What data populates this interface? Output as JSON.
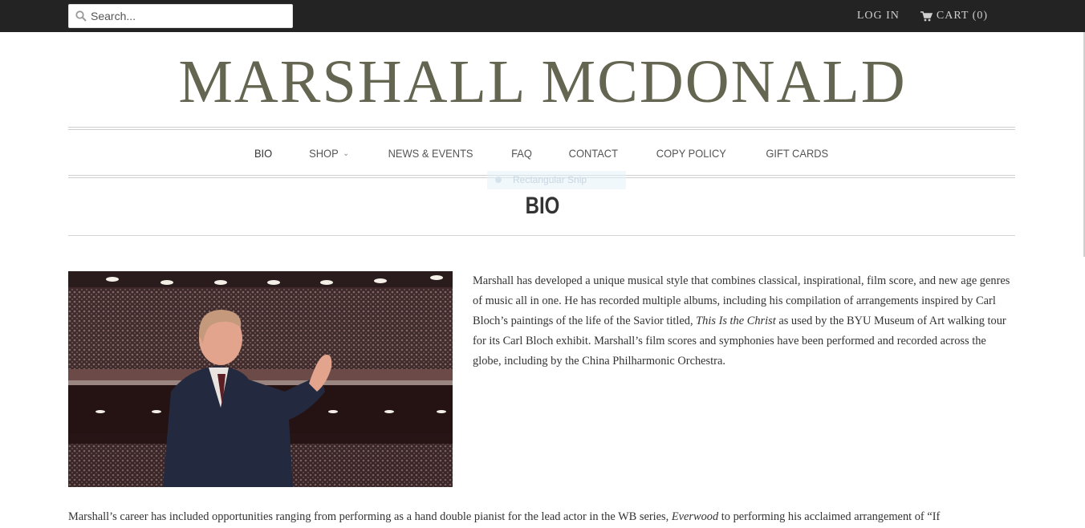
{
  "header": {
    "search_placeholder": "Search...",
    "login_label": "LOG IN",
    "cart_label": "CART (0)"
  },
  "logo": "MARSHALL MCDONALD",
  "nav": {
    "items": [
      {
        "label": "BIO"
      },
      {
        "label": "SHOP"
      },
      {
        "label": "NEWS & EVENTS"
      },
      {
        "label": "FAQ"
      },
      {
        "label": "CONTACT"
      },
      {
        "label": "COPY POLICY"
      },
      {
        "label": "GIFT CARDS"
      }
    ]
  },
  "overlay": {
    "snip_label": "Rectangular Snip"
  },
  "page": {
    "title": "BIO",
    "para1": {
      "text_a": "Marshall has developed a unique musical style that combines classical, inspirational, film score, and new age genres of music all in one. He has recorded multiple albums, including his compilation of arrangements inspired by Carl Bloch’s paintings of the life of the Savior titled, ",
      "italic": "This Is the Christ",
      "text_b": " as used by the BYU Museum of Art walking tour for its Carl Bloch exhibit. Marshall’s film scores and symphonies have been performed and recorded across the globe, including by the China Philharmonic Orchestra."
    },
    "para2": {
      "text_a": "Marshall’s career has included opportunities ranging from performing as a hand double pianist for the lead actor in the WB series, ",
      "italic": "Everwood",
      "text_b": " to performing his acclaimed arrangement of “If"
    }
  },
  "colors": {
    "topbar": "#232323",
    "logo": "#646651"
  }
}
